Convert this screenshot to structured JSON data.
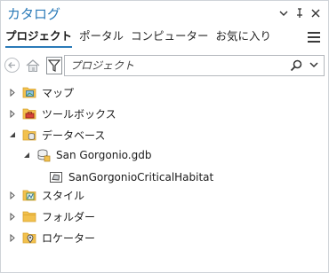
{
  "panel": {
    "title": "カタログ"
  },
  "title_controls": [
    {
      "name": "pane-options-chevron-icon",
      "glyph": "▾"
    },
    {
      "name": "pin-icon",
      "glyph": "⊥"
    },
    {
      "name": "close-icon",
      "glyph": "✕"
    }
  ],
  "tabs": [
    {
      "label": "プロジェクト",
      "active": true
    },
    {
      "label": "ポータル",
      "active": false
    },
    {
      "label": "コンピューター",
      "active": false
    },
    {
      "label": "お気に入り",
      "active": false
    }
  ],
  "search": {
    "placeholder": "プロジェクト",
    "value": ""
  },
  "tree": {
    "maps": "マップ",
    "toolboxes": "ツールボックス",
    "databases": "データベース",
    "gdb": "San Gorgonio.gdb",
    "feature_class": "SanGorgonioCriticalHabitat",
    "styles": "スタイル",
    "folders": "フォルダー",
    "locators": "ロケーター"
  },
  "colors": {
    "accent": "#2a7ab8",
    "folder": "#f2c14e",
    "folder_dark": "#d9a22e"
  }
}
